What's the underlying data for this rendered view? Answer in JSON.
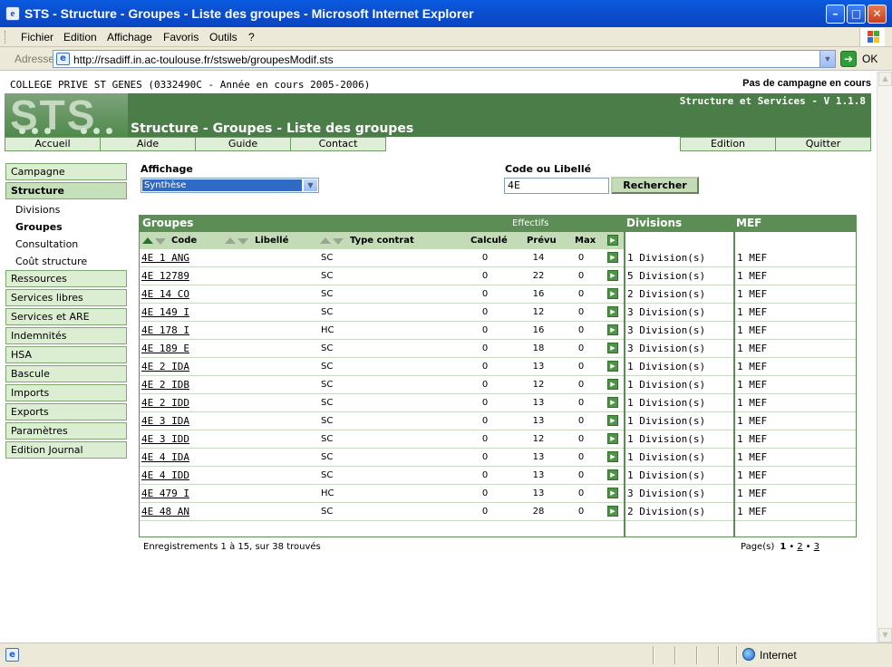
{
  "window": {
    "title": "STS - Structure - Groupes - Liste des groupes - Microsoft Internet Explorer",
    "app_icon": "ie-page-icon",
    "controls": [
      "minimize-icon",
      "maximize-icon",
      "close-icon"
    ]
  },
  "menu": [
    "Fichier",
    "Edition",
    "Affichage",
    "Favoris",
    "Outils",
    "?"
  ],
  "address": {
    "label": "Adresse",
    "url": "http://rsadiff.in.ac-toulouse.fr/stsweb/groupesModif.sts",
    "go_label": "OK"
  },
  "header": {
    "college": "COLLEGE PRIVE ST GENES (0332490C - Année en cours 2005-2006)",
    "campaign": "Pas de campagne en cours",
    "logo": "STS",
    "version": "Structure et Services - V 1.1.8",
    "page_title": "Structure - Groupes - Liste des groupes"
  },
  "tabs": {
    "left": [
      "Accueil",
      "Aide",
      "Guide",
      "Contact"
    ],
    "right": [
      "Edition",
      "Quitter"
    ]
  },
  "sidebar": {
    "top": [
      "Campagne",
      "Structure"
    ],
    "sub": [
      "Divisions",
      "Groupes",
      "Consultation",
      "Coût structure"
    ],
    "current_sub": "Groupes",
    "bottom": [
      "Ressources",
      "Services libres",
      "Services et ARE",
      "Indemnités",
      "HSA",
      "Bascule",
      "Imports",
      "Exports",
      "Paramètres",
      "Edition Journal"
    ]
  },
  "filters": {
    "display_label": "Affichage",
    "display_value": "Synthèse",
    "search_label": "Code ou Libellé",
    "search_value": "4E",
    "search_button": "Rechercher"
  },
  "grid": {
    "title": "Groupes",
    "effectifs": "Effectifs",
    "divisions_title": "Divisions",
    "mef_title": "MEF",
    "columns": {
      "code": "Code",
      "libelle": "Libellé",
      "type": "Type contrat",
      "calcule": "Calculé",
      "prevu": "Prévu",
      "max": "Max"
    },
    "rows": [
      {
        "code": "4E 1 ANG",
        "type": "SC",
        "calcule": "0",
        "prevu": "14",
        "max": "0",
        "divisions": "1 Division(s)",
        "mef": "1 MEF"
      },
      {
        "code": "4E 12789",
        "type": "SC",
        "calcule": "0",
        "prevu": "22",
        "max": "0",
        "divisions": "5 Division(s)",
        "mef": "1 MEF"
      },
      {
        "code": "4E 14 CO",
        "type": "SC",
        "calcule": "0",
        "prevu": "16",
        "max": "0",
        "divisions": "2 Division(s)",
        "mef": "1 MEF"
      },
      {
        "code": "4E 149 I",
        "type": "SC",
        "calcule": "0",
        "prevu": "12",
        "max": "0",
        "divisions": "3 Division(s)",
        "mef": "1 MEF"
      },
      {
        "code": "4E 178 I",
        "type": "HC",
        "calcule": "0",
        "prevu": "16",
        "max": "0",
        "divisions": "3 Division(s)",
        "mef": "1 MEF"
      },
      {
        "code": "4E 189 E",
        "type": "SC",
        "calcule": "0",
        "prevu": "18",
        "max": "0",
        "divisions": "3 Division(s)",
        "mef": "1 MEF"
      },
      {
        "code": "4E 2 IDA",
        "type": "SC",
        "calcule": "0",
        "prevu": "13",
        "max": "0",
        "divisions": "1 Division(s)",
        "mef": "1 MEF"
      },
      {
        "code": "4E 2 IDB",
        "type": "SC",
        "calcule": "0",
        "prevu": "12",
        "max": "0",
        "divisions": "1 Division(s)",
        "mef": "1 MEF"
      },
      {
        "code": "4E 2 IDD",
        "type": "SC",
        "calcule": "0",
        "prevu": "13",
        "max": "0",
        "divisions": "1 Division(s)",
        "mef": "1 MEF"
      },
      {
        "code": "4E 3 IDA",
        "type": "SC",
        "calcule": "0",
        "prevu": "13",
        "max": "0",
        "divisions": "1 Division(s)",
        "mef": "1 MEF"
      },
      {
        "code": "4E 3 IDD",
        "type": "SC",
        "calcule": "0",
        "prevu": "12",
        "max": "0",
        "divisions": "1 Division(s)",
        "mef": "1 MEF"
      },
      {
        "code": "4E 4 IDA",
        "type": "SC",
        "calcule": "0",
        "prevu": "13",
        "max": "0",
        "divisions": "1 Division(s)",
        "mef": "1 MEF"
      },
      {
        "code": "4E 4 IDD",
        "type": "SC",
        "calcule": "0",
        "prevu": "13",
        "max": "0",
        "divisions": "1 Division(s)",
        "mef": "1 MEF"
      },
      {
        "code": "4E 479 I",
        "type": "HC",
        "calcule": "0",
        "prevu": "13",
        "max": "0",
        "divisions": "3 Division(s)",
        "mef": "1 MEF"
      },
      {
        "code": "4E 48 AN",
        "type": "SC",
        "calcule": "0",
        "prevu": "28",
        "max": "0",
        "divisions": "2 Division(s)",
        "mef": "1 MEF"
      }
    ]
  },
  "footer": {
    "records": "Enregistrements 1 à 15, sur 38 trouvés",
    "pages_label": "Page(s)",
    "pages": [
      "1",
      "2",
      "3"
    ],
    "current_page": "1"
  },
  "statusbar": {
    "zone": "Internet"
  },
  "colors": {
    "banner": "#4a7d47",
    "grid_header": "#5b8d55",
    "subheader": "#c3dcb7",
    "sidebar": "#dceed2"
  }
}
